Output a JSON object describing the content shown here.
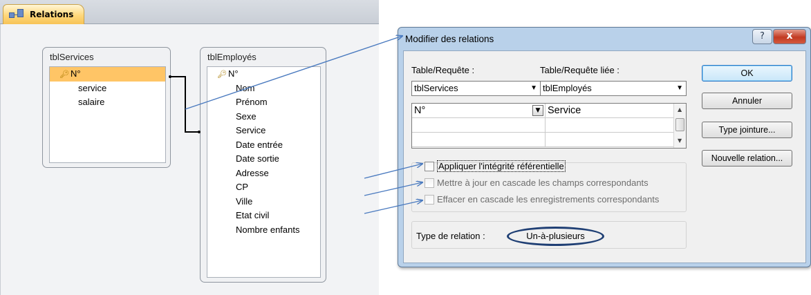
{
  "tab": {
    "label": "Relations",
    "icon": "relationships-icon"
  },
  "tables": {
    "services": {
      "name": "tblServices",
      "fields": [
        "N°",
        "service",
        "salaire"
      ],
      "primary_key": "N°"
    },
    "employes": {
      "name": "tblEmployés",
      "fields": [
        "N°",
        "Nom",
        "Prénom",
        "Sexe",
        "Service",
        "Date entrée",
        "Date sortie",
        "Adresse",
        "CP",
        "Ville",
        "Etat civil",
        "Nombre enfants"
      ],
      "primary_key": "N°"
    }
  },
  "dialog": {
    "title": "Modifier des relations",
    "help_label": "?",
    "close_label": "x",
    "table_label": "Table/Requête :",
    "related_table_label": "Table/Requête liée :",
    "table_value": "tblServices",
    "related_table_value": "tblEmployés",
    "grid": {
      "rows": [
        [
          "N°",
          "Service"
        ],
        [
          "",
          ""
        ],
        [
          "",
          ""
        ]
      ]
    },
    "checkboxes": {
      "integrity": {
        "label": "Appliquer l'intégrité référentielle",
        "checked": false
      },
      "cascade_update": {
        "label": "Mettre à jour en cascade les champs correspondants",
        "checked": false,
        "enabled": false
      },
      "cascade_delete": {
        "label": "Effacer en cascade les enregistrements correspondants",
        "checked": false,
        "enabled": false
      }
    },
    "relation_type_label": "Type de relation :",
    "relation_type_value": "Un-à-plusieurs",
    "buttons": {
      "ok": "OK",
      "cancel": "Annuler",
      "join_type": "Type jointure...",
      "new_relation": "Nouvelle relation..."
    }
  },
  "colors": {
    "arrow": "#4a7abf",
    "selected_field": "#ffc566",
    "dialog_frame": "#b9d1ea",
    "ellipse": "#1f3f74"
  }
}
